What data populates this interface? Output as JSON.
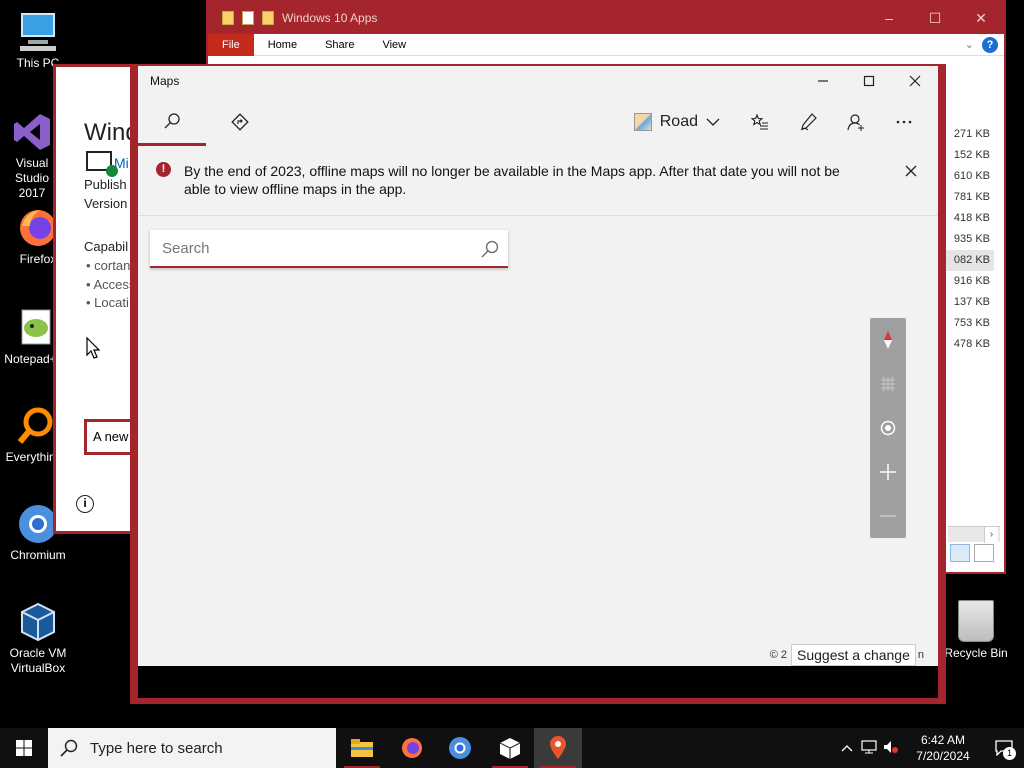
{
  "desktop": {
    "icons": [
      {
        "label": "This PC"
      },
      {
        "label": "Visual Studio 2017"
      },
      {
        "label": "Firefox"
      },
      {
        "label": "Notepad++"
      },
      {
        "label": "Everything"
      },
      {
        "label": "Chromium"
      },
      {
        "label": "Oracle VM VirtualBox"
      }
    ],
    "recycle_bin": "Recycle Bin"
  },
  "explorer": {
    "title": "Windows 10 Apps",
    "ribbon_tabs": [
      "File",
      "Home",
      "Share",
      "View"
    ],
    "sizes": [
      "271 KB",
      "152 KB",
      "610 KB",
      "781 KB",
      "418 KB",
      "935 KB",
      "082 KB",
      "916 KB",
      "137 KB",
      "753 KB",
      "478 KB"
    ]
  },
  "store": {
    "title": "Wind",
    "link": "Mi",
    "publisher": "Publish",
    "version": "Version",
    "capabilities": "Capabil",
    "bullets": [
      "• cortan",
      "• Access",
      "• Locati"
    ],
    "notice": "A new"
  },
  "maps": {
    "title": "Maps",
    "map_style": "Road",
    "banner_text": "By the end of 2023, offline maps will no longer be available in the Maps app. After that date you will not be able to view offline maps in the app.",
    "search_placeholder": "Search",
    "copyright": "© 2",
    "copyright_tail": "n",
    "suggest_change": "Suggest a change"
  },
  "taskbar": {
    "search_placeholder": "Type here to search",
    "time": "6:42 AM",
    "date": "7/20/2024",
    "notification_count": "1"
  },
  "colors": {
    "accent": "#a4262c"
  }
}
